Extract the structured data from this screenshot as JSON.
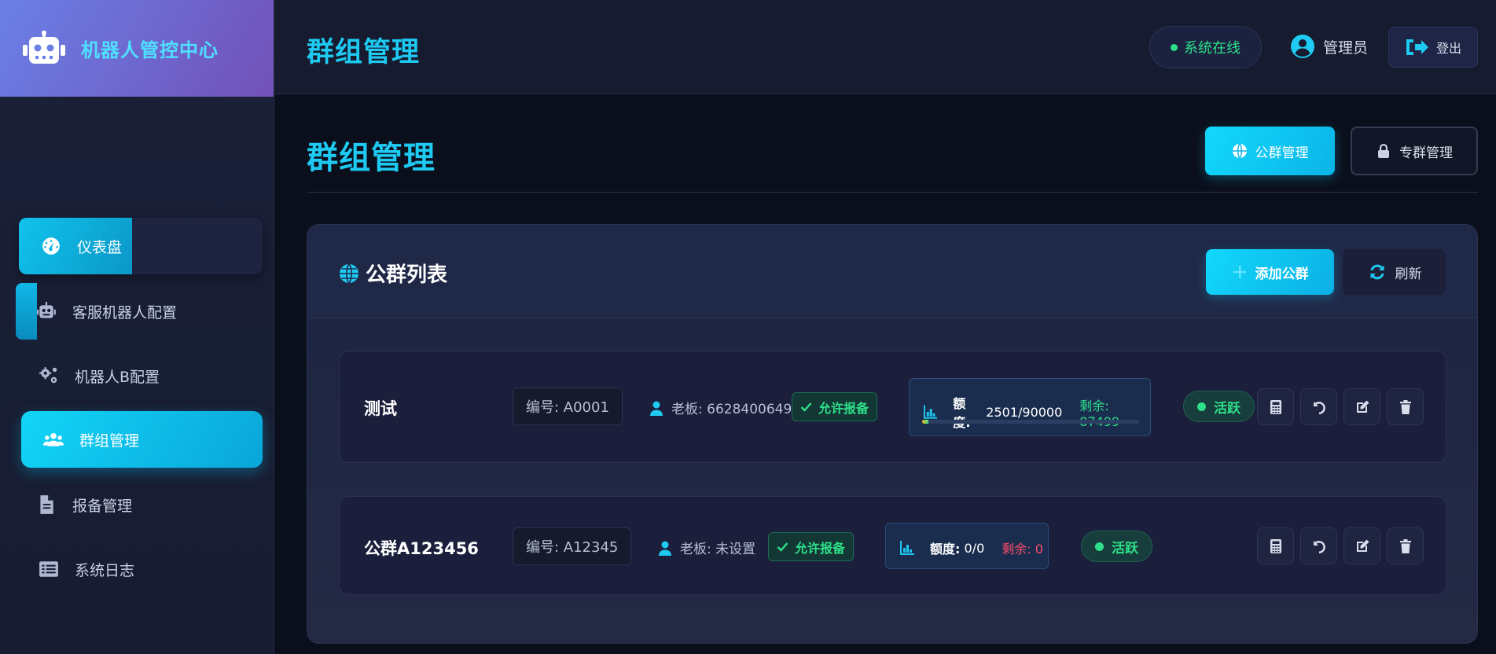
{
  "brand": {
    "title": "机器人管控中心",
    "icon": "robot-icon"
  },
  "sidebar": {
    "items": [
      {
        "label": "仪表盘",
        "icon": "gauge-icon"
      },
      {
        "label": "客服机器人配置",
        "icon": "robot-icon"
      },
      {
        "label": "机器人B配置",
        "icon": "gears-icon"
      },
      {
        "label": "群组管理",
        "icon": "users-icon",
        "active": true
      },
      {
        "label": "报备管理",
        "icon": "file-icon"
      },
      {
        "label": "系统日志",
        "icon": "list-icon"
      }
    ]
  },
  "topbar": {
    "title": "群组管理",
    "status": "系统在线",
    "user": "管理员",
    "logout": "登出"
  },
  "page": {
    "title": "群组管理",
    "public_btn": "公群管理",
    "private_btn": "专群管理"
  },
  "card": {
    "title": "公群列表",
    "add_btn": "添加公群",
    "refresh_btn": "刷新"
  },
  "groups": [
    {
      "name": "测试",
      "code": "编号: A0001",
      "boss": "老板: 6628400649",
      "allow": "允许报备",
      "quota_label": "额度:",
      "quota_value": "2501/90000",
      "remain": "剩余: 87499",
      "quota_used_fraction": 0.028,
      "status": "活跃"
    },
    {
      "name": "公群A123456",
      "code": "编号: A12345",
      "boss": "老板: 未设置",
      "allow": "允许报备",
      "quota_label": "额度:",
      "quota_value": "0/0",
      "remain": "剩余: 0",
      "status": "活跃"
    }
  ],
  "colors": {
    "accent": "#1ec9f2",
    "success": "#2ee08a",
    "danger": "#ff4d6d",
    "background": "#0b0f1c"
  }
}
